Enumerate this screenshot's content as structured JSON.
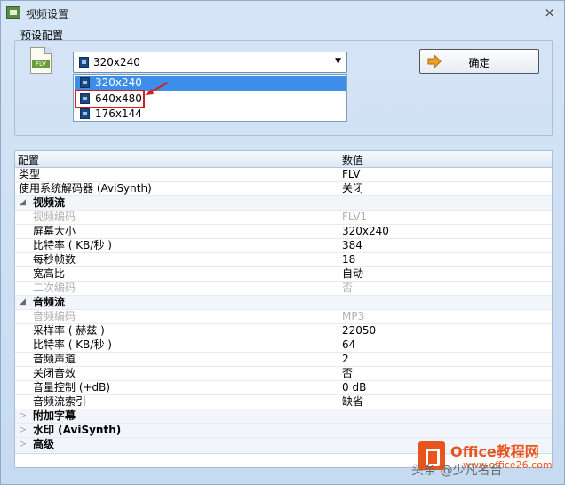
{
  "window": {
    "title": "视频设置",
    "close": "×"
  },
  "preset": {
    "label": "预设配置",
    "icon_text": "FLV",
    "selected": "320x240",
    "options": [
      "320x240",
      "640x480",
      "176x144"
    ],
    "ok_label": "确定"
  },
  "grid": {
    "headers": [
      "配置",
      "数值"
    ],
    "rows": [
      {
        "name": "类型",
        "value": "FLV"
      },
      {
        "name": "使用系统解码器 (AviSynth)",
        "value": "关闭"
      }
    ],
    "video": {
      "title": "视频流",
      "rows": [
        {
          "name": "视频编码",
          "value": "FLV1"
        },
        {
          "name": "屏幕大小",
          "value": "320x240"
        },
        {
          "name": "比特率 ( KB/秒 )",
          "value": "384"
        },
        {
          "name": "每秒帧数",
          "value": "18"
        },
        {
          "name": "宽高比",
          "value": "自动"
        },
        {
          "name": "二次编码",
          "value": "否"
        }
      ]
    },
    "audio": {
      "title": "音频流",
      "rows": [
        {
          "name": "音频编码",
          "value": "MP3"
        },
        {
          "name": "采样率 ( 赫兹 )",
          "value": "22050"
        },
        {
          "name": "比特率 ( KB/秒 )",
          "value": "64"
        },
        {
          "name": "音频声道",
          "value": "2"
        },
        {
          "name": "关闭音效",
          "value": "否"
        },
        {
          "name": "音量控制 (+dB)",
          "value": "0 dB"
        },
        {
          "name": "音频流索引",
          "value": "缺省"
        }
      ]
    },
    "collapsed": [
      "附加字幕",
      "水印 (AviSynth)",
      "高级"
    ]
  },
  "watermark": {
    "brand": "Office教程网",
    "url": "www.office26.com",
    "sig": "头条 @少",
    "tail": "凡名台"
  }
}
